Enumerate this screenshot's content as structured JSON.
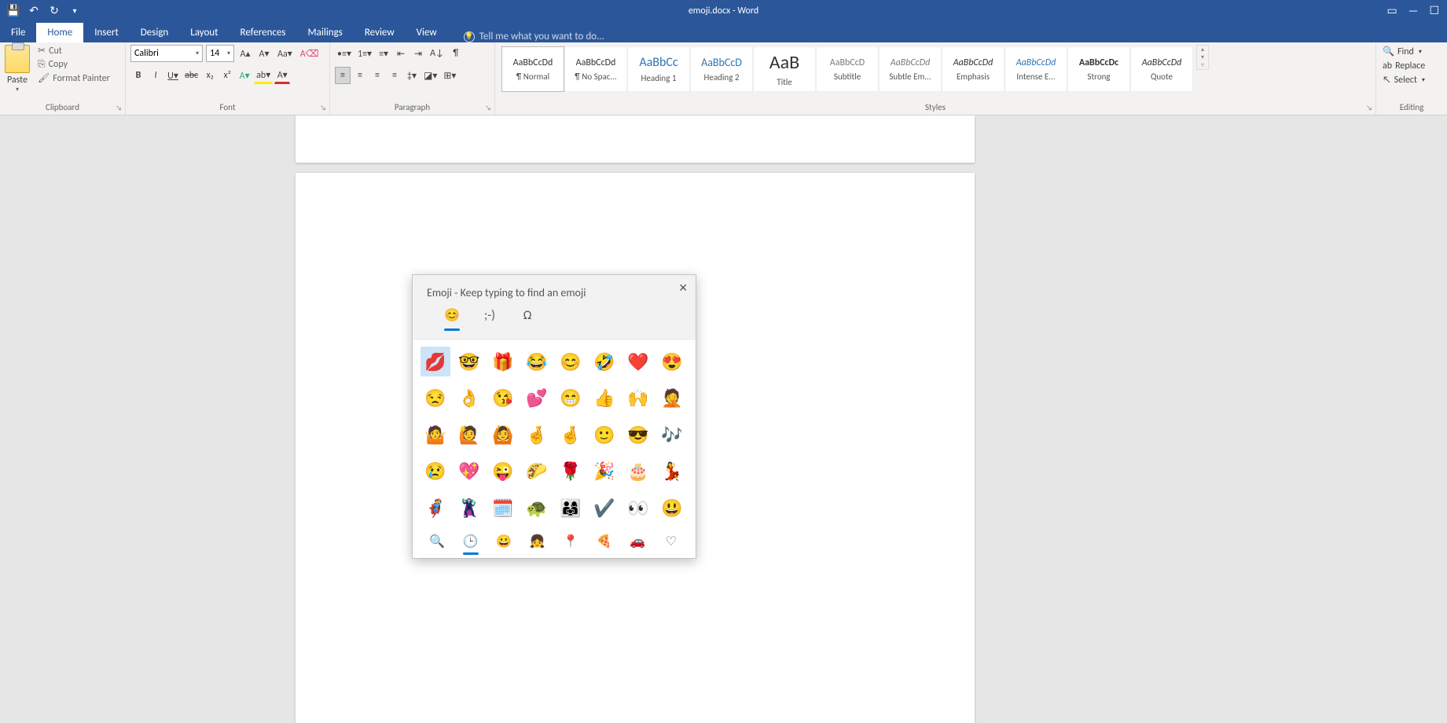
{
  "title": "emoji.docx - Word",
  "tabs": {
    "file": "File",
    "home": "Home",
    "insert": "Insert",
    "design": "Design",
    "layout": "Layout",
    "references": "References",
    "mailings": "Mailings",
    "review": "Review",
    "view": "View"
  },
  "tellme": "Tell me what you want to do...",
  "clipboard": {
    "paste": "Paste",
    "cut": "Cut",
    "copy": "Copy",
    "painter": "Format Painter",
    "label": "Clipboard"
  },
  "font": {
    "name": "Calibri",
    "size": "14",
    "label": "Font"
  },
  "paragraph": {
    "label": "Paragraph"
  },
  "styles": {
    "label": "Styles",
    "items": [
      {
        "preview": "AaBbCcDd",
        "name": "¶ Normal"
      },
      {
        "preview": "AaBbCcDd",
        "name": "¶ No Spac..."
      },
      {
        "preview": "AaBbCc",
        "name": "Heading 1",
        "color": "#2E74B5",
        "size": "16px"
      },
      {
        "preview": "AaBbCcD",
        "name": "Heading 2",
        "color": "#2E74B5",
        "size": "14px"
      },
      {
        "preview": "AaB",
        "name": "Title",
        "size": "24px"
      },
      {
        "preview": "AaBbCcD",
        "name": "Subtitle",
        "color": "#7B7B7B"
      },
      {
        "preview": "AaBbCcDd",
        "name": "Subtle Em...",
        "style": "italic",
        "color": "#7B7B7B"
      },
      {
        "preview": "AaBbCcDd",
        "name": "Emphasis",
        "style": "italic"
      },
      {
        "preview": "AaBbCcDd",
        "name": "Intense E...",
        "style": "italic",
        "color": "#2E74B5"
      },
      {
        "preview": "AaBbCcDc",
        "name": "Strong",
        "weight": "bold"
      },
      {
        "preview": "AaBbCcDd",
        "name": "Quote",
        "style": "italic"
      }
    ]
  },
  "editing": {
    "find": "Find",
    "replace": "Replace",
    "select": "Select",
    "label": "Editing"
  },
  "emoji": {
    "title": "Emoji - Keep typing to find an emoji",
    "tabs": [
      "😊",
      ";-)",
      "Ω"
    ],
    "grid": [
      "💋",
      "🤓",
      "🎁",
      "😂",
      "😊",
      "🤣",
      "❤️",
      "😍",
      "😒",
      "👌",
      "😘",
      "💕",
      "😁",
      "👍",
      "🙌",
      "🤦",
      "🤷",
      "🙋",
      "🙆",
      "🤞",
      "🤞",
      "🙂",
      "😎",
      "🎶",
      "😢",
      "💖",
      "😜",
      "🌮",
      "🌹",
      "🎉",
      "🎂",
      "💃",
      "🦸",
      "🦹",
      "🗓️",
      "🐢",
      "👨‍👩‍👧",
      "✔️",
      "👀",
      "😃"
    ],
    "cats": [
      "🔍",
      "🕒",
      "😀",
      "👧",
      "📍",
      "🍕",
      "🚗",
      "♡"
    ]
  }
}
